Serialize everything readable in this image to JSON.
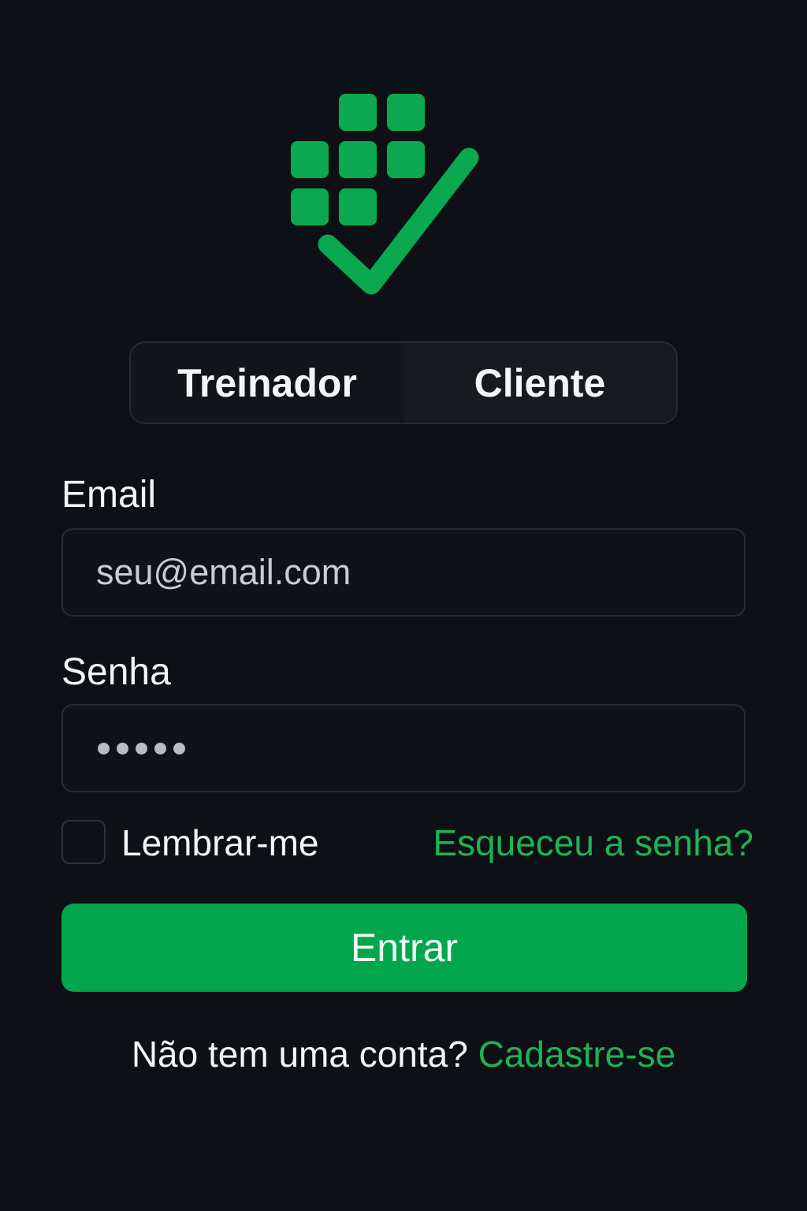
{
  "app": {
    "logo_icon": "calendar-grid-checkmark-icon",
    "accent_color": "#04a64c",
    "link_color": "#1fb256",
    "background_color": "#0d1116"
  },
  "role_toggle": {
    "tabs": [
      {
        "label": "Treinador",
        "selected": true
      },
      {
        "label": "Cliente",
        "selected": false
      }
    ]
  },
  "form": {
    "email": {
      "label": "Email",
      "placeholder": "seu@email.com",
      "value": ""
    },
    "password": {
      "label": "Senha",
      "masked_length": 5
    },
    "remember": {
      "label": "Lembrar-me",
      "checked": false
    },
    "forgot_password_label": "Esqueceu a senha?",
    "submit_label": "Entrar"
  },
  "signup": {
    "prompt": "Não tem uma conta?",
    "link_label": "Cadastre-se"
  }
}
